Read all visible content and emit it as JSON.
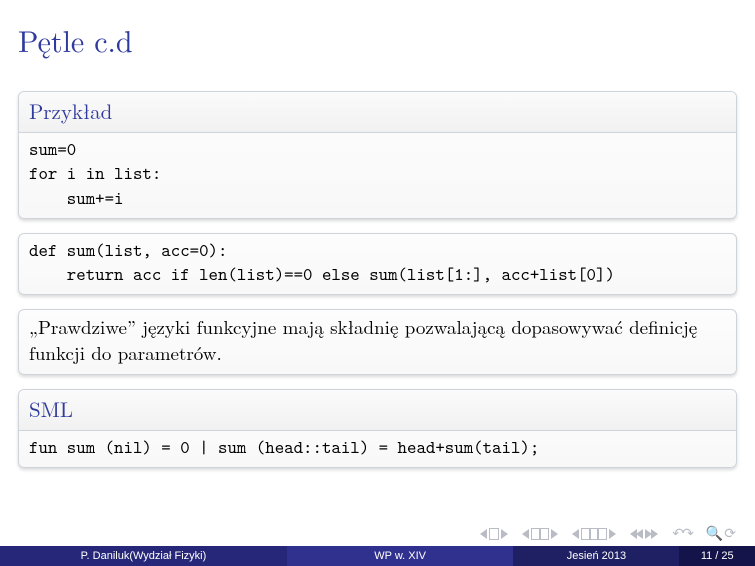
{
  "title": "Pętle c.d",
  "blocks": {
    "example": {
      "header": "Przykład",
      "code": "sum=0\nfor i in list:\n    sum+=i"
    },
    "defblock": {
      "code": "def sum(list, acc=0):\n    return acc if len(list)==0 else sum(list[1:], acc+list[0])"
    },
    "text": {
      "body": "„Prawdziwe” języki funkcyjne mają składnię pozwalającą dopasowywać definicję funkcji do parametrów."
    },
    "sml": {
      "header": "SML",
      "code": "fun sum (nil) = 0 | sum (head::tail) = head+sum(tail);"
    }
  },
  "footer": {
    "author": "P. Daniluk(Wydział Fizyki)",
    "mid": "WP w. XIV",
    "date": "Jesień 2013",
    "page": "11 / 25"
  },
  "navicons": {
    "first": "first-slide",
    "prev": "prev-slide",
    "next": "next-slide",
    "last": "last-slide",
    "back": "go-back",
    "search": "search",
    "refresh": "refresh"
  }
}
